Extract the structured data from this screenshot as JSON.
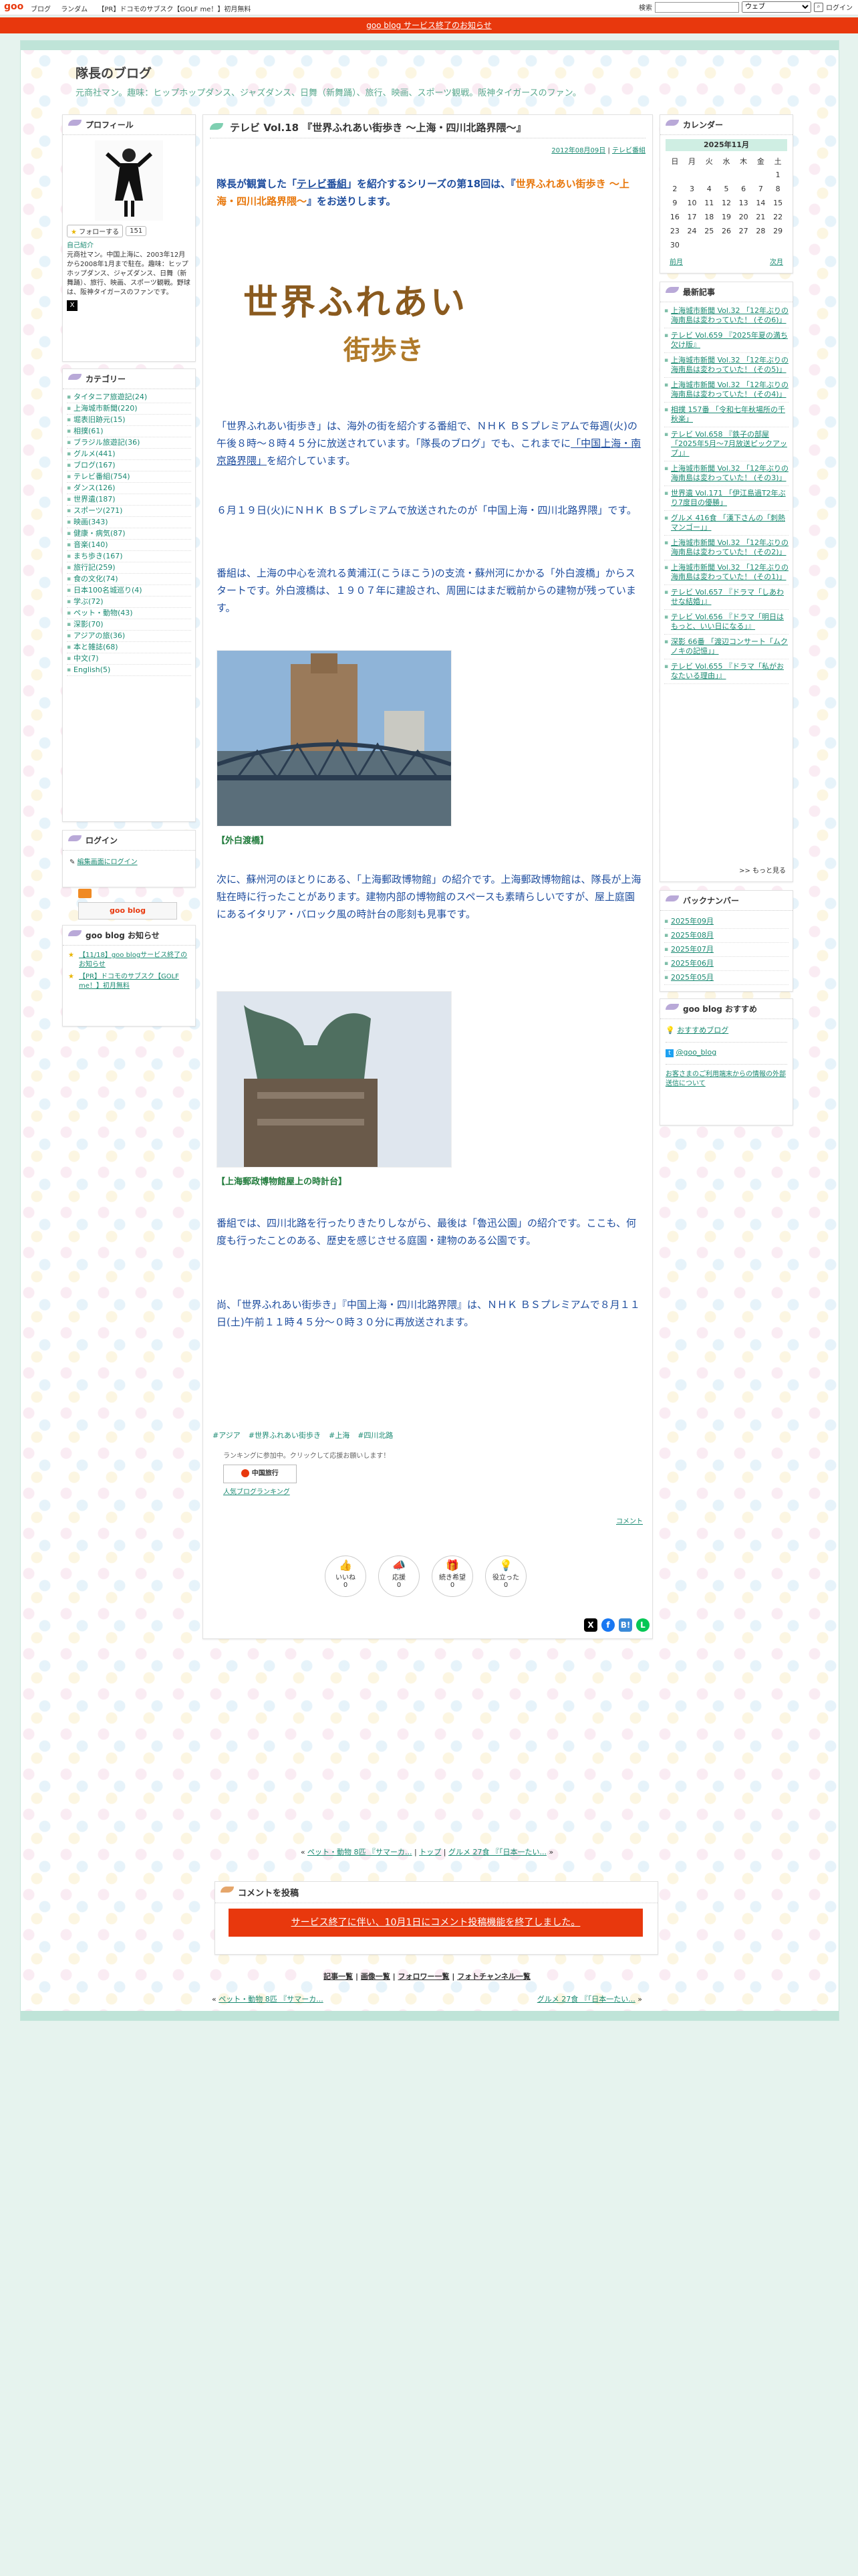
{
  "topbar": {
    "logo": "goo",
    "links": [
      "ブログ",
      "ランダム",
      "【PR】ドコモのサブスク【GOLF me！】初月無料"
    ],
    "search_label": "検索",
    "search_scope": "ウェブ",
    "login": "ログイン"
  },
  "notice": "goo blog サービス終了のお知らせ",
  "blog": {
    "title": "隊長のブログ",
    "subtitle": "元商社マン。趣味：ヒップホップダンス、ジャズダンス、日舞（新舞踊）、旅行、映画、スポーツ観戦。阪神タイガースのファン。"
  },
  "profile": {
    "title": "プロフィール",
    "follow": "フォローする",
    "follow_count": "151",
    "intro_link": "自己紹介",
    "intro": "元商社マン。中国上海に、2003年12月から2008年1月まで駐在。趣味：ヒップホップダンス、ジャズダンス、日舞（新舞踊）、旅行、映画、スポーツ観戦。野球は、阪神タイガースのファンです。"
  },
  "categories": {
    "title": "カテゴリー",
    "items": [
      "タイタニア旅遊記(24)",
      "上海城市新聞(220)",
      "堀表旧跡元(15)",
      "相撲(61)",
      "ブラジル旅遊記(36)",
      "グルメ(441)",
      "ブログ(167)",
      "テレビ番組(754)",
      "ダンス(126)",
      "世界遺(187)",
      "スポーツ(271)",
      "映画(343)",
      "健康・病気(87)",
      "音楽(140)",
      "まち歩き(167)",
      "旅行記(259)",
      "食の文化(74)",
      "日本100名城巡り(4)",
      "学ぶ(72)",
      "ペット・動物(43)",
      "深影(70)",
      "アジアの旅(36)",
      "本と雑誌(68)",
      "中文(7)",
      "English(5)"
    ]
  },
  "login": {
    "title": "ログイン",
    "link": "編集画面にログイン"
  },
  "goo_logo": "goo blog",
  "news": {
    "title": "goo blog お知らせ",
    "items": [
      "【11/18】goo blogサービス終了のお知らせ",
      "【PR】ドコモのサブスク【GOLF me！】初月無料"
    ]
  },
  "article": {
    "title": "テレビ Vol.18 『世界ふれあい街歩き 〜上海・四川北路界隈〜』",
    "date": "2012年08月09日",
    "category": "テレビ番組",
    "intro_a": "隊長が観賞した「",
    "intro_link": "テレビ番組",
    "intro_b": "」を紹介するシリーズの第18回は、『",
    "intro_orange": "世界ふれあい街歩き 〜上海・四川北路界隈〜",
    "intro_c": "』をお送りします。",
    "logo_line1": "世界ふれあい",
    "logo_line2": "街歩き",
    "p1_a": "「世界ふれあい街歩き」は、海外の街を紹介する番組で、ＮＨＫ ＢＳプレミアムで毎週(火)の午後８時〜８時４５分に放送されています。「隊長のブログ」でも、これまでに",
    "p1_link": "「中国上海・南京路界隈」",
    "p1_b": "を紹介しています。",
    "p2": "６月１９日(火)にＮＨＫ ＢＳプレミアムで放送されたのが「中国上海・四川北路界隈」です。",
    "p3": "番組は、上海の中心を流れる黄浦江(こうほこう)の支流・蘇州河にかかる「外白渡橋」からスタートです。外白渡橋は、１９０７年に建設され、周囲にはまだ戦前からの建物が残っています。",
    "cap1": "【外白渡橋】",
    "p4": "次に、蘇州河のほとりにある、「上海郵政博物館」の紹介です。上海郵政博物館は、隊長が上海駐在時に行ったことがあります。建物内部の博物館のスペースも素晴らしいですが、屋上庭園にあるイタリア・バロック風の時計台の彫刻も見事です。",
    "cap2": "【上海郵政博物館屋上の時計台】",
    "p5": "番組では、四川北路を行ったりきたりしながら、最後は「魯迅公園」の紹介です。ここも、何度も行ったことのある、歴史を感じさせる庭園・建物のある公園です。",
    "p6": "尚、「世界ふれあい街歩き」『中国上海・四川北路界隈』は、ＮＨＫ ＢＳプレミアムで８月１１日(土)午前１１時４５分〜０時３０分に再放送されます。",
    "tags": [
      "#アジア",
      "#世界ふれあい街歩き",
      "#上海",
      "#四川北路"
    ],
    "ranking_text": "ランキングに参加中。クリックして応援お願いします！",
    "ranking_badge": "中国旅行",
    "ranking_link": "人気ブログランキング",
    "comment_link": "コメント",
    "reactions": [
      {
        "label": "いいね",
        "count": "0"
      },
      {
        "label": "応援",
        "count": "0"
      },
      {
        "label": "続き希望",
        "count": "0"
      },
      {
        "label": "役立った",
        "count": "0"
      }
    ]
  },
  "pager": {
    "prev": "ペット・動物 8匹 『サマーカ...",
    "top": "トップ",
    "next": "グルメ 27食 『「日本一たい...",
    "sep": "|"
  },
  "comment": {
    "title": "コメントを投稿",
    "closed": "サービス終了に伴い、10月1日にコメント投稿機能を終了しました。"
  },
  "footer_links": [
    "記事一覧",
    "画像一覧",
    "フォロワー一覧",
    "フォトチャンネル一覧"
  ],
  "calendar": {
    "title": "カレンダー",
    "month": "2025年11月",
    "weekdays": [
      "日",
      "月",
      "火",
      "水",
      "木",
      "金",
      "土"
    ],
    "rows": [
      [
        "",
        "",
        "",
        "",
        "",
        "",
        "1"
      ],
      [
        "2",
        "3",
        "4",
        "5",
        "6",
        "7",
        "8"
      ],
      [
        "9",
        "10",
        "11",
        "12",
        "13",
        "14",
        "15"
      ],
      [
        "16",
        "17",
        "18",
        "19",
        "20",
        "21",
        "22"
      ],
      [
        "23",
        "24",
        "25",
        "26",
        "27",
        "28",
        "29"
      ],
      [
        "30",
        "",
        "",
        "",
        "",
        "",
        ""
      ]
    ],
    "prev": "前月",
    "next": "次月"
  },
  "recent": {
    "title": "最新記事",
    "items": [
      "上海城市新聞 Vol.32 「12年ぶりの海南島は変わっていた！ (その6)」",
      "テレビ Vol.659 『2025年夏の満ち欠け版』",
      "上海城市新聞 Vol.32 「12年ぶりの海南島は変わっていた！ (その5)」",
      "上海城市新聞 Vol.32 「12年ぶりの海南島は変わっていた！ (その4)」",
      "相撲 157番 「令和七年秋場所の千秋楽」",
      "テレビ Vol.658 『鉄子の部屋 「2025年5月〜7月放送ピックアップ」』",
      "上海城市新聞 Vol.32 「12年ぶりの海南島は変わっていた！ (その3)」",
      "世界遺 Vol.171 「伊江島過T2年ぶり7度目の優勝」",
      "グルメ 416食 「漢下さんの「刺熱マンゴー」」",
      "上海城市新聞 Vol.32 「12年ぶりの海南島は変わっていた！ (その2)」",
      "上海城市新聞 Vol.32 「12年ぶりの海南島は変わっていた！ (その1)」",
      "テレビ Vol.657 『ドラマ「しあわせな結婚」』",
      "テレビ Vol.656 『ドラマ「明日はもっと、いい日になる」』",
      "深影 66番 「渡辺コンサート「ムクノキの記憶」」",
      "テレビ Vol.655 『ドラマ「私がおなたいる理由」』"
    ],
    "more": ">> もっと見る"
  },
  "backnumber": {
    "title": "バックナンバー",
    "items": [
      "2025年09月",
      "2025年08月",
      "2025年07月",
      "2025年06月",
      "2025年05月"
    ]
  },
  "recommend": {
    "title": "goo blog おすすめ",
    "item": "おすすめブログ",
    "twitter": "@goo_blog",
    "note": "お客さまのご利用端末からの情報の外部送信について"
  }
}
